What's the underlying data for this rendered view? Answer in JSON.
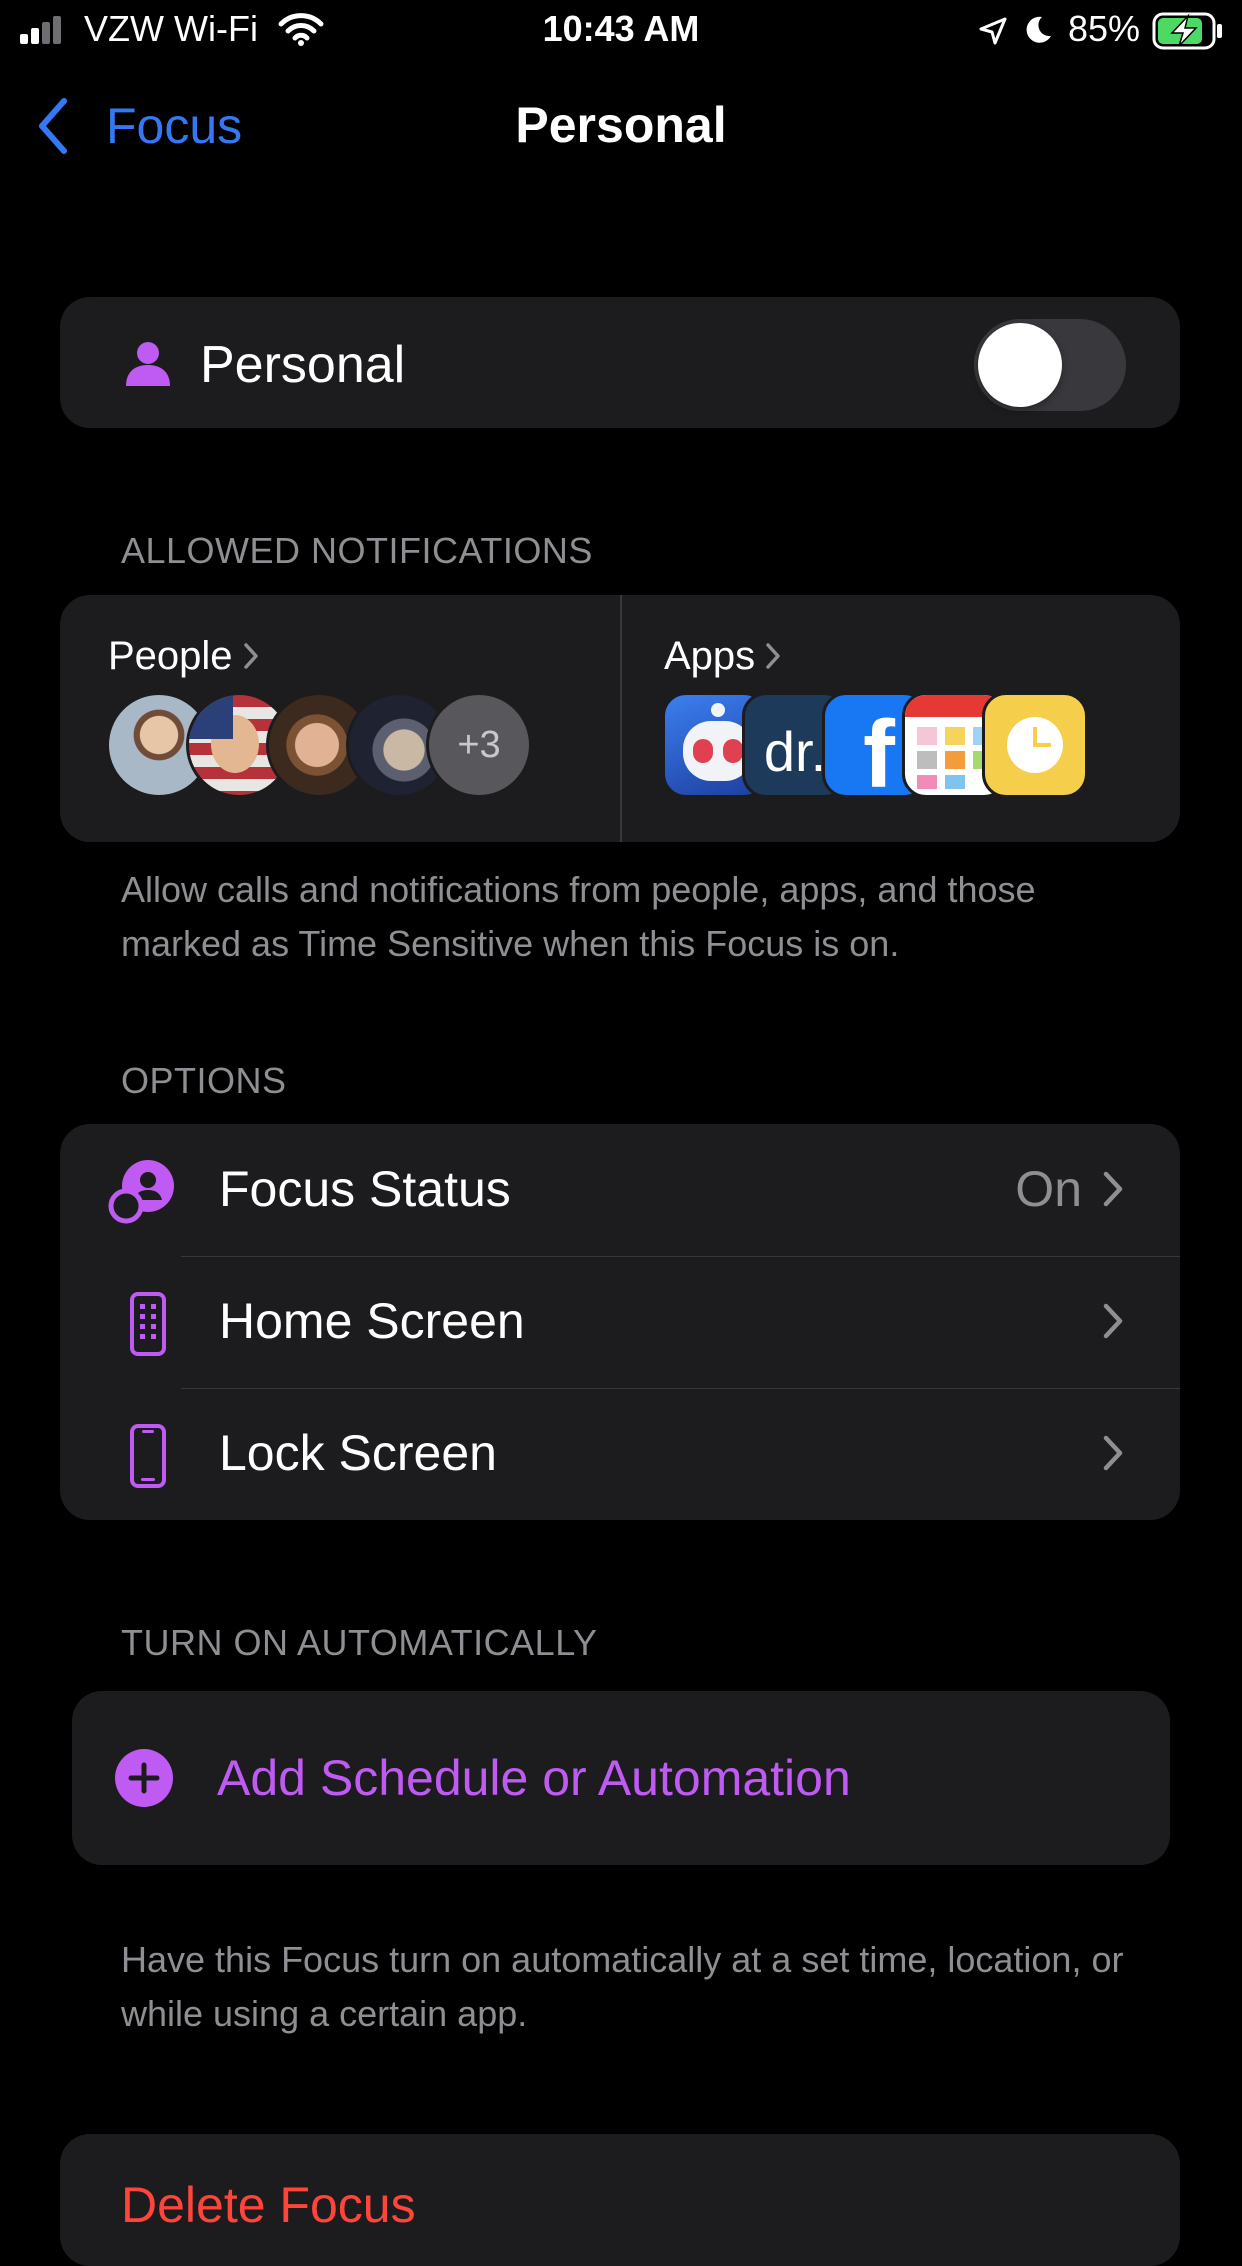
{
  "status_bar": {
    "carrier": "VZW Wi-Fi",
    "time": "10:43 AM",
    "battery": "85%",
    "battery_level": 0.85
  },
  "nav": {
    "back_label": "Focus",
    "title": "Personal"
  },
  "focus_toggle": {
    "label": "Personal",
    "on": false,
    "icon": "person-icon"
  },
  "allowed_notifications": {
    "header": "ALLOWED NOTIFICATIONS",
    "people": {
      "label": "People",
      "more_count": "+3"
    },
    "apps": {
      "label": "Apps",
      "icons": [
        "tweetbot-icon",
        "dr-app-icon",
        "facebook-icon",
        "calendar-grid-icon",
        "clock-icon"
      ]
    },
    "footer": "Allow calls and notifications from people, apps, and those marked as Time Sensitive when this Focus is on."
  },
  "options": {
    "header": "OPTIONS",
    "items": [
      {
        "label": "Focus Status",
        "value": "On",
        "icon": "focus-status-icon"
      },
      {
        "label": "Home Screen",
        "value": "",
        "icon": "home-screen-icon"
      },
      {
        "label": "Lock Screen",
        "value": "",
        "icon": "lock-screen-icon"
      }
    ]
  },
  "automation": {
    "header": "TURN ON AUTOMATICALLY",
    "add_label": "Add Schedule or Automation",
    "footer": "Have this Focus turn on automatically at a set time, location, or while using a certain app."
  },
  "delete": {
    "label": "Delete Focus"
  },
  "colors": {
    "accent_purple": "#bf5af2",
    "link_blue": "#3478f6",
    "destructive_red": "#ff453a",
    "cell_bg": "#1c1c1e",
    "secondary_text": "#8e8e93"
  }
}
